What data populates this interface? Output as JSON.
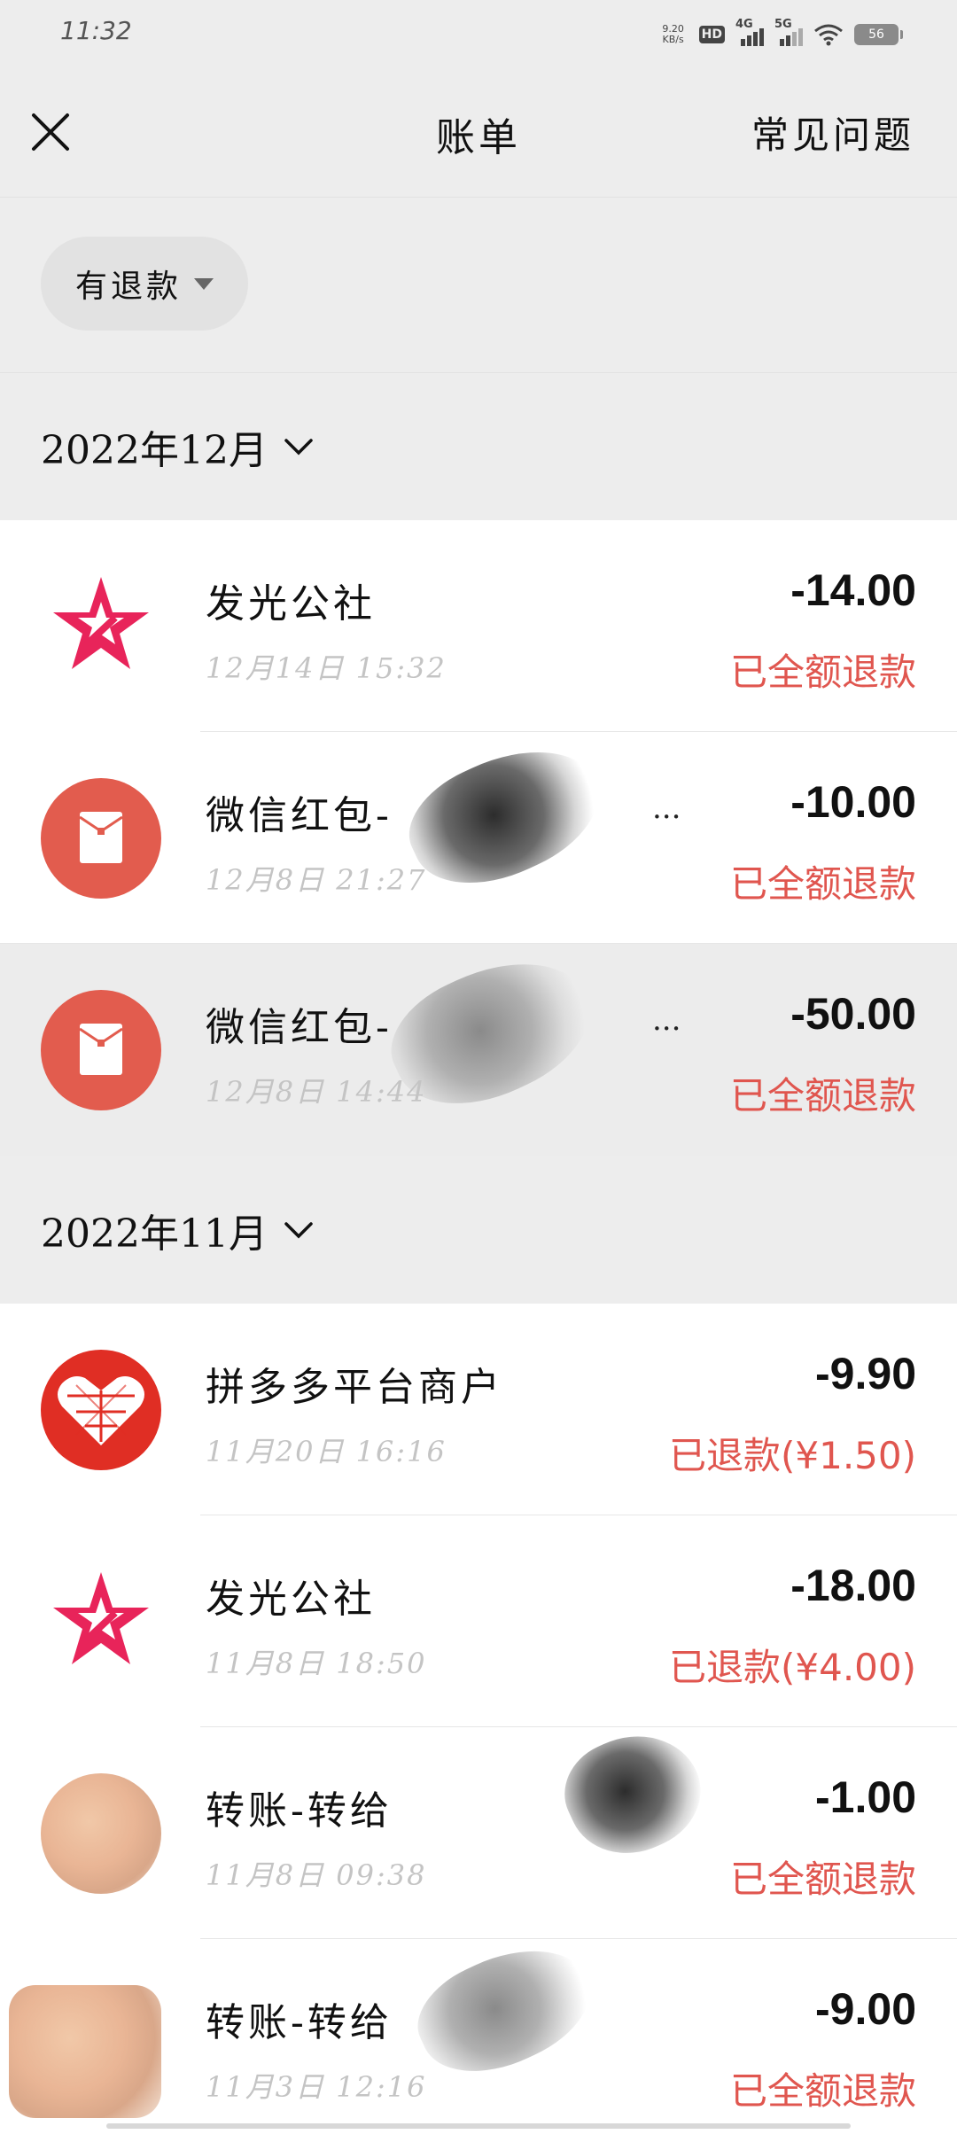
{
  "status_bar": {
    "time": "11:32",
    "net_speed": "9.20",
    "net_unit": "KB/s",
    "hd": "HD",
    "sim1": "4G",
    "sim2": "5G",
    "battery": "56"
  },
  "header": {
    "close_icon": "close-icon",
    "title": "账单",
    "faq": "常见问题"
  },
  "filter": {
    "label": "有退款",
    "icon": "triangle-down-icon"
  },
  "months": [
    {
      "label": "2022年12月",
      "rows": [
        {
          "icon": "star-logo",
          "name": "发光公社",
          "time": "12月14日 15:32",
          "amount": "-14.00",
          "status": "已全额退款"
        },
        {
          "icon": "red-packet-icon",
          "name": "微信红包-",
          "time": "12月8日 21:27",
          "amount": "-10.00",
          "status": "已全额退款"
        },
        {
          "icon": "red-packet-icon",
          "name": "微信红包-",
          "time": "12月8日 14:44",
          "amount": "-50.00",
          "status": "已全额退款"
        }
      ]
    },
    {
      "label": "2022年11月",
      "rows": [
        {
          "icon": "pinduoduo-logo",
          "name": "拼多多平台商户",
          "time": "11月20日 16:16",
          "amount": "-9.90",
          "status": "已退款(¥1.50)"
        },
        {
          "icon": "star-logo",
          "name": "发光公社",
          "time": "11月8日 18:50",
          "amount": "-18.00",
          "status": "已退款(¥4.00)"
        },
        {
          "icon": "user-avatar",
          "name": "转账-转给",
          "time": "11月8日 09:38",
          "amount": "-1.00",
          "status": "已全额退款"
        },
        {
          "icon": "user-avatar",
          "name": "转账-转给",
          "time": "11月3日 12:16",
          "amount": "-9.00",
          "status": "已全额退款"
        }
      ]
    }
  ],
  "ellipsis": "...",
  "colors": {
    "background": "#ededed",
    "refund_red": "#e0564f",
    "star_red": "#e8245a",
    "packet_red": "#e25c4e",
    "pdd_red": "#e02e24"
  }
}
